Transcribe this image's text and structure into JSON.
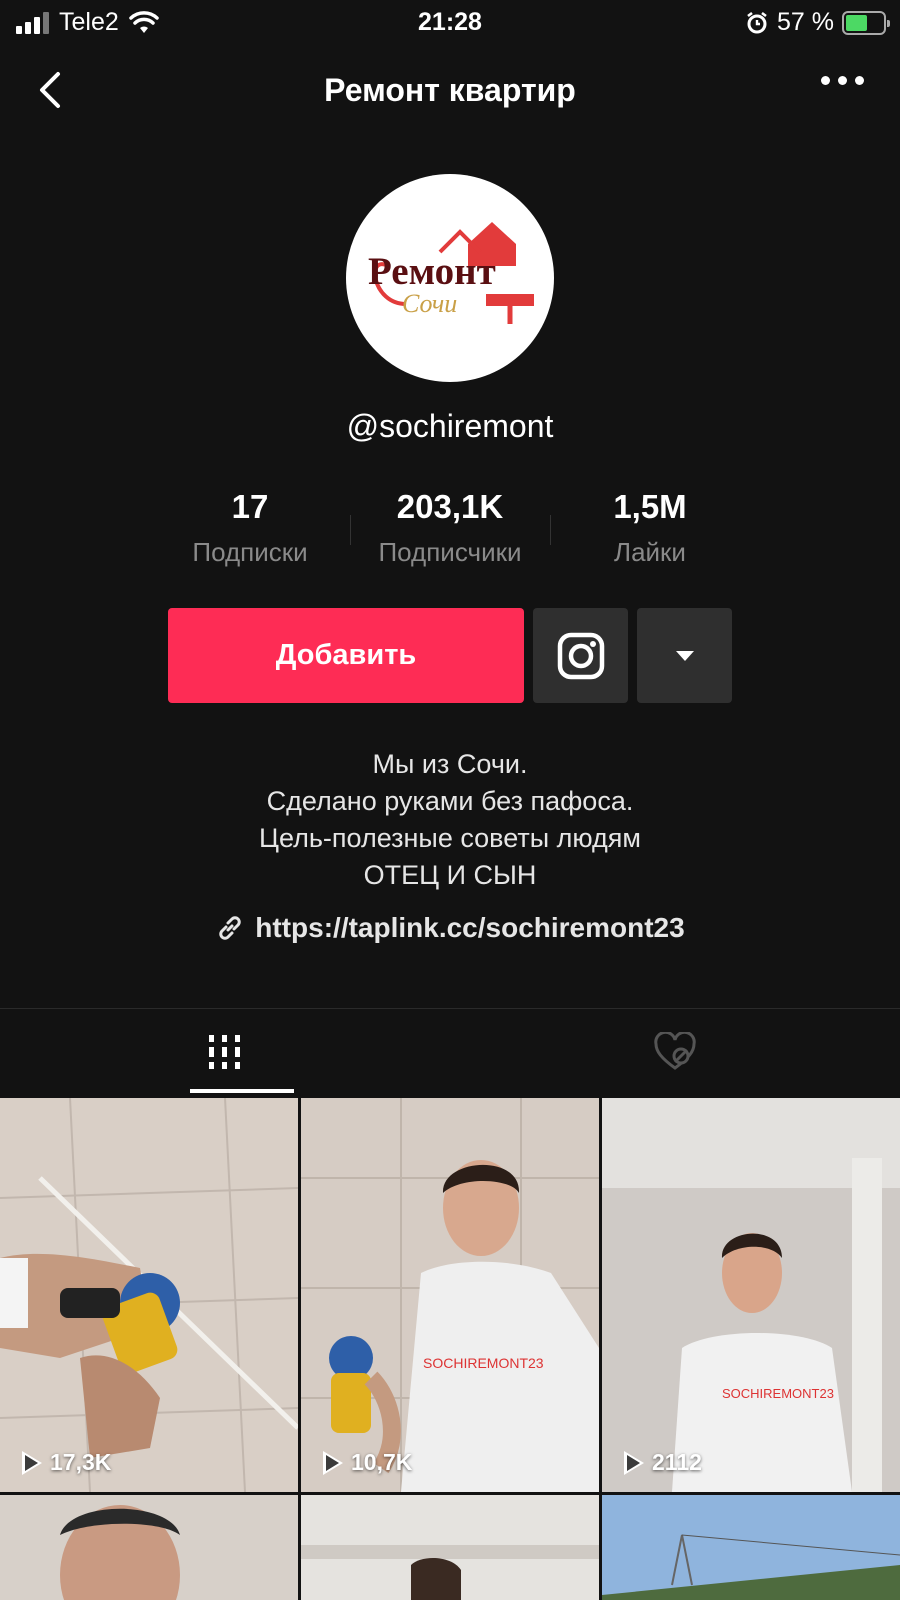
{
  "status": {
    "carrier": "Tele2",
    "time": "21:28",
    "battery": "57 %",
    "battery_level": 0.57
  },
  "nav": {
    "title": "Ремонт квартир"
  },
  "profile": {
    "logo_text_main": "Ремонт",
    "logo_text_script": "Сочи",
    "username": "@sochiremont",
    "stats": [
      {
        "value": "17",
        "label": "Подписки"
      },
      {
        "value": "203,1K",
        "label": "Подписчики"
      },
      {
        "value": "1,5M",
        "label": "Лайки"
      }
    ],
    "add_button": "Добавить",
    "bio": [
      "Мы из Сочи.",
      "Сделано руками без пафоса.",
      "Цель-полезные советы людям",
      "ОТЕЦ И СЫН"
    ],
    "link": "https://taplink.cc/sochiremont23"
  },
  "colors": {
    "accent": "#fe2c55",
    "background": "#121212",
    "button_secondary": "#2f2f2f"
  },
  "videos": [
    {
      "views": "17,3K",
      "shirt_text": ""
    },
    {
      "views": "10,7K",
      "shirt_text": "SOCHIREMONT23"
    },
    {
      "views": "2112",
      "shirt_text": "SOCHIREMONT23"
    },
    {
      "views": ""
    },
    {
      "views": ""
    },
    {
      "views": ""
    }
  ]
}
